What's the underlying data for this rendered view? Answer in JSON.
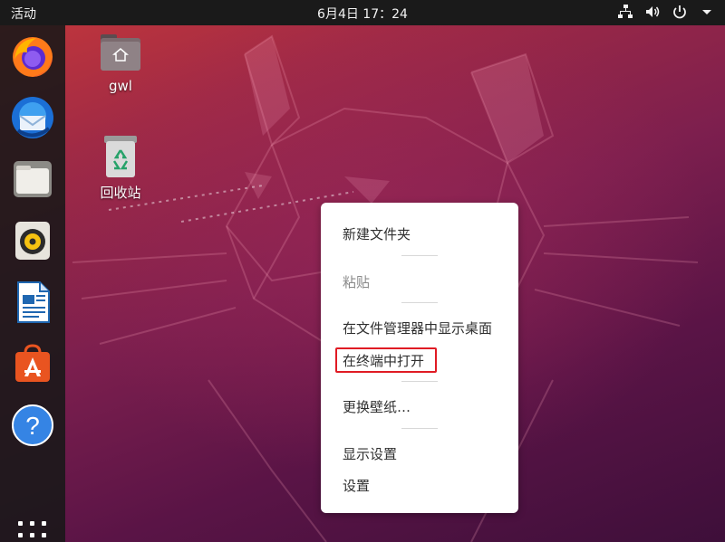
{
  "topbar": {
    "activities": "活动",
    "clock": "6月4日  17：24",
    "tray_icons": [
      "network-icon",
      "volume-icon",
      "power-icon",
      "chevron-down-icon"
    ]
  },
  "dock": {
    "items": [
      {
        "name": "firefox",
        "icon": "firefox-icon"
      },
      {
        "name": "thunderbird",
        "icon": "thunderbird-mail-icon"
      },
      {
        "name": "files",
        "icon": "files-folder-icon"
      },
      {
        "name": "rhythmbox",
        "icon": "rhythmbox-speaker-icon"
      },
      {
        "name": "libreoffice-writer",
        "icon": "writer-document-icon"
      },
      {
        "name": "ubuntu-software",
        "icon": "software-store-icon"
      },
      {
        "name": "help",
        "icon": "help-icon"
      }
    ],
    "show_apps_icon": "app-grid-icon"
  },
  "desktop": {
    "home_label": "gwl",
    "trash_label": "回收站"
  },
  "context_menu": {
    "new_folder": "新建文件夹",
    "paste": "粘贴",
    "show_in_files": "在文件管理器中显示桌面",
    "open_terminal": "在终端中打开",
    "change_background": "更换壁纸…",
    "display_settings": "显示设置",
    "settings": "设置"
  },
  "colors": {
    "topbar": "#1a1a1a",
    "menu_bg": "#ffffff",
    "highlight": "#e01b24",
    "ubuntu_orange": "#e95420"
  }
}
